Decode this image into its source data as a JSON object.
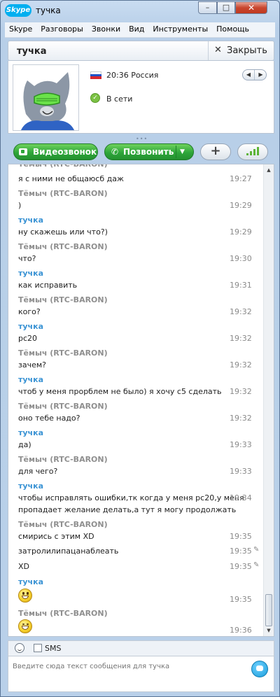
{
  "window": {
    "app_logo": "Skype",
    "title": "тучка"
  },
  "menu": [
    "Skype",
    "Разговоры",
    "Звонки",
    "Вид",
    "Инструменты",
    "Помощь"
  ],
  "contact": {
    "name": "тучка",
    "close_label": "Закрыть",
    "local_time": "20:36 Россия",
    "status": "В сети",
    "flag": "russia-flag-icon"
  },
  "actions": {
    "video_call": "Видеозвонок",
    "call": "Позвонить"
  },
  "messages": [
    {
      "author": "",
      "text": "я с ними не общаюсб даж",
      "time": "19:27"
    },
    {
      "author": "Тёмыч (RTC-BARON)",
      "text": ")",
      "time": "19:29"
    },
    {
      "author": "тучка",
      "text": "ну скажешь или что?)",
      "time": "19:29"
    },
    {
      "author": "Тёмыч (RTC-BARON)",
      "text": "что?",
      "time": "19:30"
    },
    {
      "author": "тучка",
      "text": "как исправить",
      "time": "19:31"
    },
    {
      "author": "Тёмыч (RTC-BARON)",
      "text": "кого?",
      "time": "19:32"
    },
    {
      "author": "тучка",
      "text": "pc20",
      "time": "19:32"
    },
    {
      "author": "Тёмыч (RTC-BARON)",
      "text": "зачем?",
      "time": "19:32"
    },
    {
      "author": "тучка",
      "text": "чтоб у меня проpблем не было) я хочу с5 сделать",
      "time": "19:32"
    },
    {
      "author": "Тёмыч (RTC-BARON)",
      "text": "оно тебе надо?",
      "time": "19:32"
    },
    {
      "author": "тучка",
      "text": "да)",
      "time": "19:33"
    },
    {
      "author": "Тёмыч (RTC-BARON)",
      "text": "для чего?",
      "time": "19:33"
    },
    {
      "author": "тучка",
      "text": "чтобы исправлять ошибки,тк когда у меня pc20,у меня",
      "text2": "пропадает желание делать,а тут я могу продолжать",
      "time": "19:34"
    },
    {
      "author": "Тёмыч (RTC-BARON)",
      "text": "смирись с этим XD",
      "time": "19:35"
    },
    {
      "author": "",
      "text": "затролилипацанаблеать",
      "time": "19:35"
    },
    {
      "author": "",
      "text": "XD",
      "time": "19:35"
    },
    {
      "author": "тучка",
      "text": "",
      "time": "19:35",
      "emoticon": "grin-emoticon"
    },
    {
      "author": "Тёмыч (RTC-BARON)",
      "text": "",
      "time": "19:36",
      "emoticon": "laugh-emoticon"
    }
  ],
  "input": {
    "sms_label": "SMS",
    "placeholder": "Введите сюда текст сообщения для тучка"
  },
  "colors": {
    "accent_green": "#2ea63a",
    "my_name": "#3a93d4",
    "their_name": "#8f8f8f",
    "skype_blue": "#00aff0"
  }
}
